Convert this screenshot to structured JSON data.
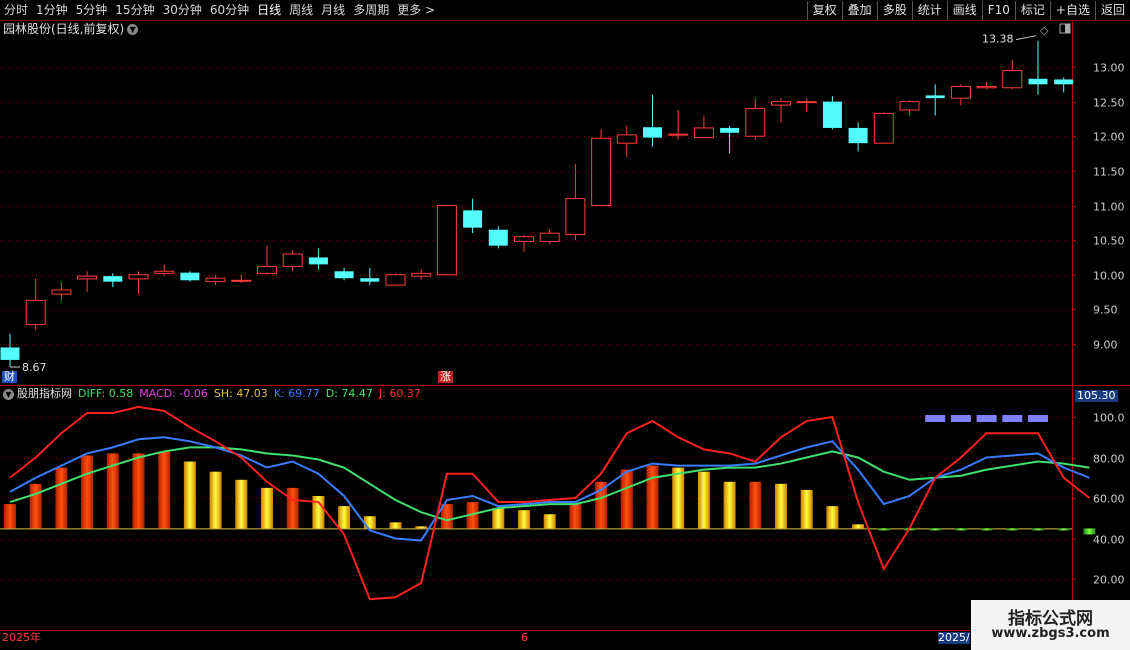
{
  "toolbar": {
    "periods": [
      "分时",
      "1分钟",
      "5分钟",
      "15分钟",
      "30分钟",
      "60分钟",
      "日线",
      "周线",
      "月线",
      "多周期",
      "更多 >"
    ],
    "active": "日线",
    "right_buttons": [
      "复权",
      "叠加",
      "多股",
      "统计",
      "画线",
      "F10",
      "标记",
      "+自选",
      "返回"
    ]
  },
  "main": {
    "title": "园林股份(日线,前复权)",
    "max_label": "13.38",
    "min_label": "8.67",
    "cai_badge": "财",
    "zhang_badge": "涨",
    "price_ticks": [
      "13.00",
      "12.50",
      "12.00",
      "11.50",
      "11.00",
      "10.50",
      "10.00",
      "9.50",
      "9.00"
    ],
    "candles": [
      [
        8.95,
        8.77,
        9.15,
        8.67
      ],
      [
        9.28,
        9.63,
        9.95,
        9.2
      ],
      [
        9.72,
        9.78,
        9.9,
        9.62
      ],
      [
        9.94,
        9.98,
        10.05,
        9.75
      ],
      [
        9.98,
        9.9,
        10.02,
        9.82
      ],
      [
        9.94,
        10.0,
        10.05,
        9.73
      ],
      [
        10.02,
        10.05,
        10.15,
        9.98
      ],
      [
        10.03,
        9.92,
        10.05,
        9.9
      ],
      [
        9.9,
        9.95,
        10.0,
        9.85
      ],
      [
        9.91,
        9.92,
        10.0,
        9.88
      ],
      [
        10.02,
        10.12,
        10.42,
        10.0
      ],
      [
        10.12,
        10.3,
        10.35,
        10.05
      ],
      [
        10.25,
        10.15,
        10.38,
        10.08
      ],
      [
        10.05,
        9.95,
        10.1,
        9.92
      ],
      [
        9.95,
        9.9,
        10.1,
        9.85
      ],
      [
        9.85,
        10.0,
        10.02,
        9.85
      ],
      [
        9.98,
        10.02,
        10.08,
        9.93
      ],
      [
        10.0,
        11.0,
        11.0,
        10.0
      ],
      [
        10.93,
        10.68,
        11.1,
        10.6
      ],
      [
        10.65,
        10.42,
        10.7,
        10.38
      ],
      [
        10.48,
        10.55,
        10.58,
        10.33
      ],
      [
        10.48,
        10.6,
        10.66,
        10.44
      ],
      [
        10.58,
        11.1,
        11.6,
        10.5
      ],
      [
        11.0,
        11.97,
        12.1,
        11.0
      ],
      [
        11.9,
        12.02,
        12.15,
        11.7
      ],
      [
        12.13,
        11.98,
        12.6,
        11.85
      ],
      [
        12.03,
        12.03,
        12.38,
        11.95
      ],
      [
        11.98,
        12.12,
        12.3,
        11.97
      ],
      [
        12.12,
        12.05,
        12.15,
        11.75
      ],
      [
        12.0,
        12.4,
        12.55,
        11.95
      ],
      [
        12.45,
        12.5,
        12.55,
        12.2
      ],
      [
        12.5,
        12.5,
        12.55,
        12.35
      ],
      [
        12.5,
        12.12,
        12.58,
        12.1
      ],
      [
        12.12,
        11.9,
        12.2,
        11.78
      ],
      [
        11.9,
        12.33,
        12.35,
        11.9
      ],
      [
        12.38,
        12.5,
        12.52,
        12.3
      ],
      [
        12.59,
        12.55,
        12.75,
        12.3
      ],
      [
        12.55,
        12.72,
        12.75,
        12.45
      ],
      [
        12.7,
        12.72,
        12.78,
        12.68
      ],
      [
        12.7,
        12.95,
        13.1,
        12.68
      ],
      [
        12.83,
        12.75,
        13.38,
        12.6
      ],
      [
        12.82,
        12.75,
        12.85,
        12.63
      ]
    ]
  },
  "indicator": {
    "name": "股朋指标网",
    "diff": "DIFF: 0.58",
    "macd": "MACD: -0.06",
    "sh": "SH: 47.03",
    "k": "K: 69.77",
    "d": "D: 74.47",
    "j": "J: 60.37",
    "top_value": "105.30",
    "y_ticks": [
      "100.0",
      "80.00",
      "60.00",
      "40.00",
      "20.00"
    ],
    "k_values": [
      63,
      70,
      76,
      82,
      85,
      89,
      90,
      88,
      85,
      81,
      75,
      78,
      72,
      61,
      44,
      40,
      39,
      59,
      61,
      56,
      57,
      58,
      58,
      64,
      73,
      77,
      76,
      76,
      76,
      77,
      81,
      85,
      88,
      74,
      57,
      61,
      70,
      74,
      80,
      81,
      82,
      75,
      70
    ],
    "d_values": [
      58,
      62,
      67,
      72,
      76,
      80,
      83,
      85,
      85,
      84,
      82,
      81,
      79,
      75,
      67,
      59,
      53,
      49,
      52,
      55,
      56,
      57,
      57,
      60,
      65,
      70,
      72,
      74,
      75,
      75,
      77,
      80,
      83,
      80,
      73,
      69,
      70,
      71,
      74,
      76,
      78,
      77,
      75
    ],
    "j_values": [
      70,
      80,
      92,
      102,
      102,
      105,
      103,
      95,
      88,
      80,
      68,
      59,
      58,
      42,
      10,
      11,
      18,
      72,
      72,
      58,
      58,
      59,
      60,
      72,
      92,
      98,
      90,
      84,
      82,
      78,
      90,
      98,
      100,
      58,
      25,
      45,
      70,
      80,
      92,
      92,
      92,
      70,
      60
    ],
    "bars": [
      57,
      67,
      75,
      81,
      82,
      82,
      83,
      78,
      73,
      69,
      65,
      65,
      61,
      56,
      51,
      48,
      46,
      57,
      58,
      55,
      54,
      52,
      57,
      68,
      74,
      76,
      75,
      73,
      68,
      68,
      67,
      64,
      56,
      47,
      45,
      45,
      44,
      44,
      45,
      45,
      45,
      44,
      42
    ],
    "purple_marks": [
      36,
      37,
      38,
      39,
      40
    ]
  },
  "time_axis": {
    "labels": [
      "2025年",
      "6",
      "2025/"
    ]
  },
  "watermark": {
    "line1": "指标公式网",
    "line2": "www.zbgs3.com"
  },
  "colors": {
    "up": "#ff3b3b",
    "down": "#54fcfc",
    "grid": "#7a0000",
    "k": "#3a7cff",
    "d": "#40e070",
    "j": "#ff2020"
  }
}
